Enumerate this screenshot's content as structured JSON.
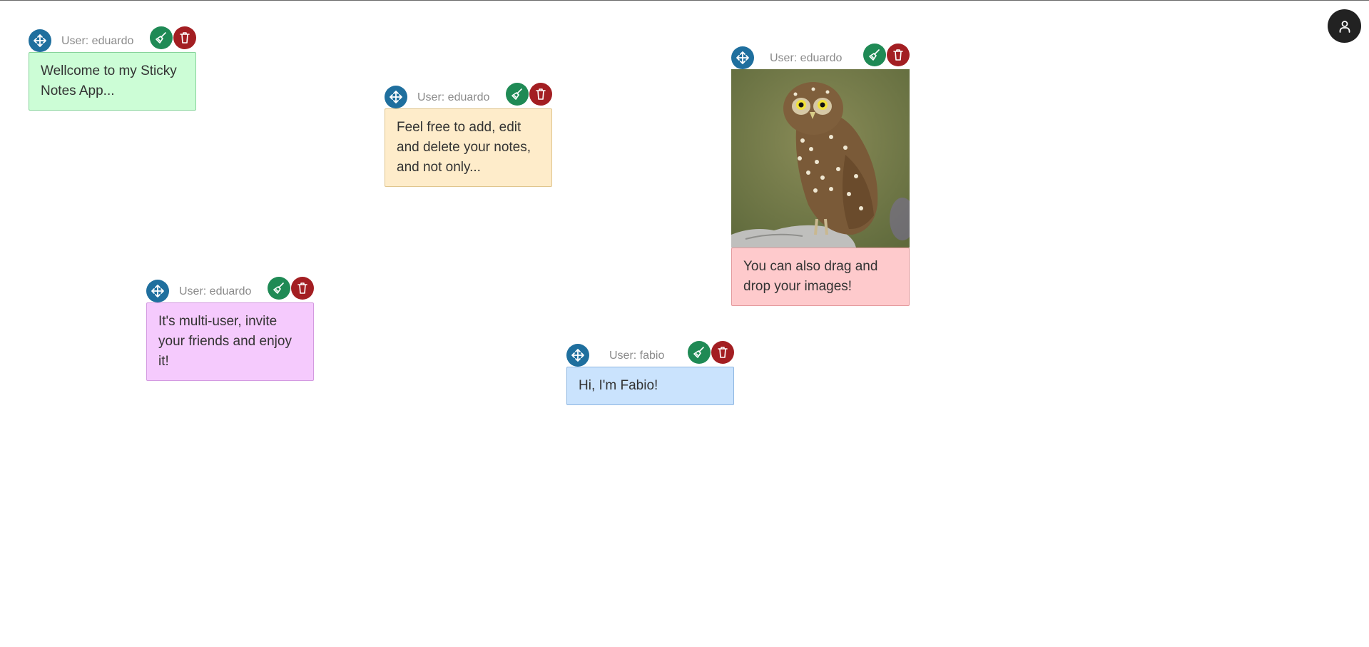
{
  "app": {
    "avatar_icon": "user-icon"
  },
  "icons": {
    "move": "move-icon",
    "edit": "broom-icon",
    "delete": "trash-icon"
  },
  "colors": {
    "move_button": "#1f6f9e",
    "edit_button": "#1f8a55",
    "delete_button": "#a31e22",
    "avatar_button": "#222222"
  },
  "notes": [
    {
      "user": "User: eduardo",
      "text": "Wellcome to my Sticky Notes App...",
      "bg": "#ccfdd6",
      "border": "#86d39a"
    },
    {
      "user": "User: eduardo",
      "text": "Feel free to add, edit and delete your notes, and not only...",
      "bg": "#feecca",
      "border": "#e0c58e"
    },
    {
      "user": "User: eduardo",
      "text": "You can also drag and drop your images!",
      "bg": "#fecacc",
      "border": "#e3999c",
      "image": "owl perched on rock"
    },
    {
      "user": "User: eduardo",
      "text": "It's multi-user, invite your friends and enjoy it!",
      "bg": "#f5cafd",
      "border": "#d39ae0"
    },
    {
      "user": "User: fabio",
      "text": "Hi, I'm Fabio!",
      "bg": "#cae3fd",
      "border": "#8fb7e2"
    }
  ]
}
